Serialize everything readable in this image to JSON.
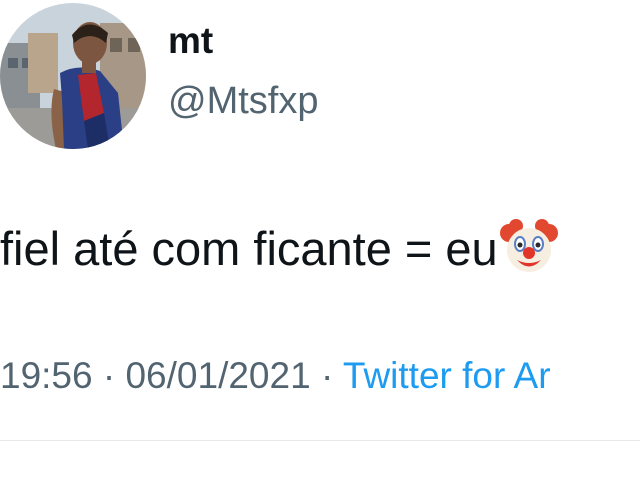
{
  "user": {
    "display_name": "mt",
    "handle": "@Mtsfxp"
  },
  "tweet": {
    "text": "fiel até com ficante = eu",
    "emoji": "clown-face"
  },
  "meta": {
    "time": "19:56",
    "separator_1": " · ",
    "date": "06/01/2021",
    "separator_2": " · ",
    "source": "Twitter for Ar"
  },
  "colors": {
    "text_primary": "#0f1419",
    "text_secondary": "#536471",
    "link": "#1d9bf0",
    "divider": "#e6e9ec"
  }
}
